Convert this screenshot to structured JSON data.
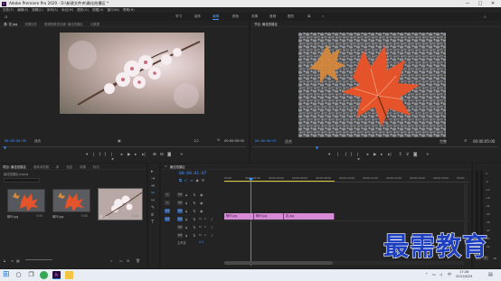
{
  "window": {
    "title": "Adobe Premiere Pro 2020 - D:\\新建文件夹\\最佳拍摄区 *",
    "minimize": "—",
    "maximize": "□",
    "close": "✕"
  },
  "menu": [
    "文件(F)",
    "编辑(E)",
    "剪辑(C)",
    "序列(S)",
    "标记(M)",
    "图形(G)",
    "视图(V)",
    "窗口(W)",
    "帮助(H)"
  ],
  "workspaces": [
    "学习",
    "组件",
    "编辑",
    "颜色",
    "效果",
    "音频",
    "图形",
    "库"
  ],
  "workspace_more": "»",
  "source_panel": {
    "tabs": [
      "源: 花.jpg",
      "效果控件",
      "音频剪辑混合器: 最佳拍摄区",
      "元数据"
    ],
    "timecode_in": "00:00:00:00",
    "fit_label": "适合",
    "scale_label": "1/2",
    "timecode_out": "00:00:05:00"
  },
  "program_panel": {
    "tabs": [
      "节目: 最佳拍摄区"
    ],
    "timecode_in": "00:00:00:07",
    "fit_label": "适合",
    "scale_label": "完整",
    "timecode_out": "00:00:05:00"
  },
  "project_panel": {
    "tabs": [
      "项目: 最佳拍摄区",
      "媒体浏览器",
      "库",
      "信息",
      "效果",
      "标记"
    ],
    "project_file": "最佳拍摄区.prproj",
    "items": [
      {
        "name": "枫叶.jpg",
        "duration": "5:00"
      },
      {
        "name": "枫叶.jpg",
        "duration": "5:00"
      },
      {
        "name": "花.jpg",
        "duration": "5:00"
      }
    ]
  },
  "timeline_panel": {
    "tab": "最佳拍摄区",
    "timecode": "00:00:01:07",
    "ruler": [
      "00:00",
      "00:00:02:00",
      "00:00:04:00",
      "00:00:06:00",
      "00:00:08:00",
      "00:00:10:00",
      "00:00:12:00",
      "00:00:14:00",
      "00:00:16:00",
      "00:00:18:00",
      "00:00:"
    ],
    "tracks": [
      {
        "id": "V3",
        "label": "V3"
      },
      {
        "id": "V2",
        "label": "V2"
      },
      {
        "id": "V1",
        "label": "V1"
      },
      {
        "id": "A1",
        "label": "A1"
      },
      {
        "id": "A2",
        "label": "A2"
      },
      {
        "id": "A3",
        "label": "A3"
      }
    ],
    "master_label": "主声道",
    "master_value": "0.0",
    "clips": [
      "枫叶.jpg",
      "枫叶.jpg",
      "花.jpg"
    ],
    "meter_scale": [
      "0",
      "-6",
      "-12",
      "-18",
      "-24",
      "-30",
      "-36",
      "-42",
      "-48",
      "-54"
    ],
    "meter_bottom": "dB",
    "meter_s": "S"
  },
  "watermark": "最需教育",
  "taskbar": {
    "time": "17:28",
    "date": "2021/6/24",
    "lang": "中",
    "colors": {
      "windows": "#1976d2",
      "premiere": "#2a0a3d",
      "chrome": "#34a853",
      "folder": "#f4c542"
    }
  },
  "colors": {
    "timecode": "#3f8dff",
    "clip": "#d78ad6",
    "playhead": "#3f8dff",
    "watermark": "#1d3fbf"
  }
}
